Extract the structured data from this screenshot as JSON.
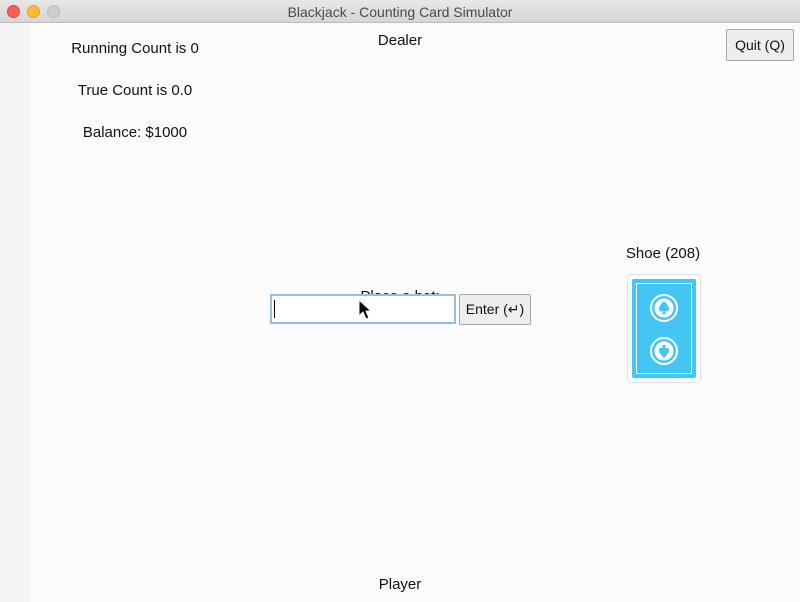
{
  "window": {
    "title": "Blackjack - Counting Card Simulator"
  },
  "stats": {
    "running_count": "Running Count is 0",
    "true_count": "True Count is 0.0",
    "balance": "Balance: $1000"
  },
  "table": {
    "dealer_label": "Dealer",
    "player_label": "Player"
  },
  "controls": {
    "quit_label": "Quit (Q)",
    "bet_prompt": "Place a bet:",
    "bet_value": "",
    "enter_label": "Enter (↵)"
  },
  "shoe": {
    "label": "Shoe (208)",
    "card_back_color": "#44c6f4",
    "icon": "spade-emblem-icon"
  }
}
